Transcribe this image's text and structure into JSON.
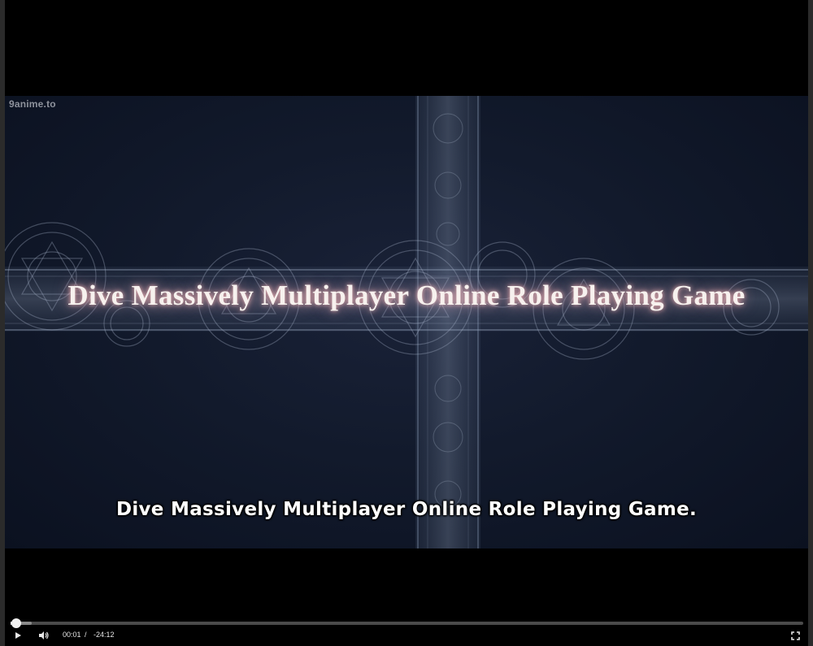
{
  "player": {
    "watermark": "9anime.to",
    "title_card": "Dive Massively Multiplayer Online Role Playing Game",
    "subtitle": "Dive Massively Multiplayer Online Role Playing Game.",
    "progress_fraction": 0.001,
    "buffered_fraction": 0.012
  },
  "controls": {
    "play_icon": "play-icon",
    "volume_icon": "volume-icon",
    "fullscreen_icon": "fullscreen-icon",
    "current_time": "00:01",
    "time_separator": "/",
    "remaining_time": "-24:12"
  },
  "colors": {
    "title_glow": "#ffbebe",
    "frame_bg": "#121a2c",
    "control_fg": "#e6e6e6"
  }
}
